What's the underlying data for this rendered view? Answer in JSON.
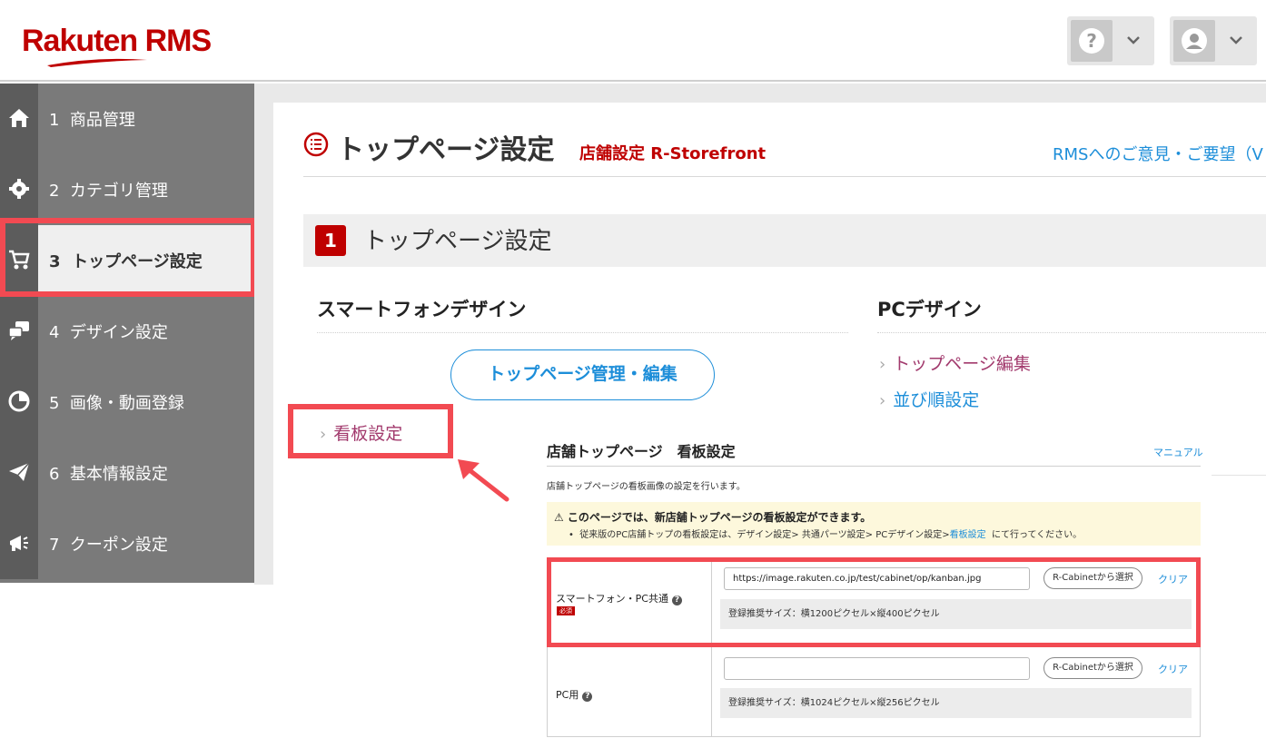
{
  "header": {
    "logo_text": "Rakuten RMS",
    "help_icon": "question-circle-icon",
    "user_icon": "user-icon",
    "brand_color": "#bf0000"
  },
  "sidebar": {
    "items": [
      {
        "num": "1",
        "label": "商品管理",
        "icon": "home-icon"
      },
      {
        "num": "2",
        "label": "カテゴリ管理",
        "icon": "gear-icon"
      },
      {
        "num": "3",
        "label": "トップページ設定",
        "icon": "cart-icon",
        "active": true
      },
      {
        "num": "4",
        "label": "デザイン設定",
        "icon": "chat-bubbles-icon"
      },
      {
        "num": "5",
        "label": "画像・動画登録",
        "icon": "pie-chart-icon"
      },
      {
        "num": "6",
        "label": "基本情報設定",
        "icon": "paper-plane-icon"
      },
      {
        "num": "7",
        "label": "クーポン設定",
        "icon": "megaphone-icon"
      }
    ]
  },
  "page": {
    "title": "トップページ設定",
    "subtitle": "店舗設定 R-Storefront",
    "feedback_link": "RMSへのご意見・ご要望（V",
    "section_num": "1",
    "section_title": "トップページ設定"
  },
  "smartphone": {
    "heading": "スマートフォンデザイン",
    "button": "トップページ管理・編集",
    "link": "看板設定"
  },
  "pc": {
    "heading": "PCデザイン",
    "links": [
      "トップページ編集",
      "並び順設定"
    ]
  },
  "inset": {
    "title": "店舗トップページ　看板設定",
    "manual": "マニュアル",
    "description": "店舗トップページの看板画像の設定を行います。",
    "notice_main": "⚠ このページでは、新店舗トップページの看板設定ができます。",
    "notice_sub_before": "従来版のPC店舗トップの看板設定は、デザイン設定> 共通パーツ設定> PCデザイン設定>",
    "notice_sub_link": "看板設定",
    "notice_sub_after": "にて行ってください。",
    "rows": [
      {
        "label": "スマートフォン・PC共通",
        "required": "必須",
        "value": "https://image.rakuten.co.jp/test/cabinet/op/kanban.jpg",
        "cabinet": "R-Cabinetから選択",
        "clear": "クリア",
        "hint": "登録推奨サイズ：横1200ピクセル×縦400ピクセル"
      },
      {
        "label": "PC用",
        "value": "",
        "cabinet": "R-Cabinetから選択",
        "clear": "クリア",
        "hint": "登録推奨サイズ：横1024ピクセル×縦256ピクセル"
      }
    ]
  },
  "annotation": {
    "highlight_color": "#f24a52"
  }
}
